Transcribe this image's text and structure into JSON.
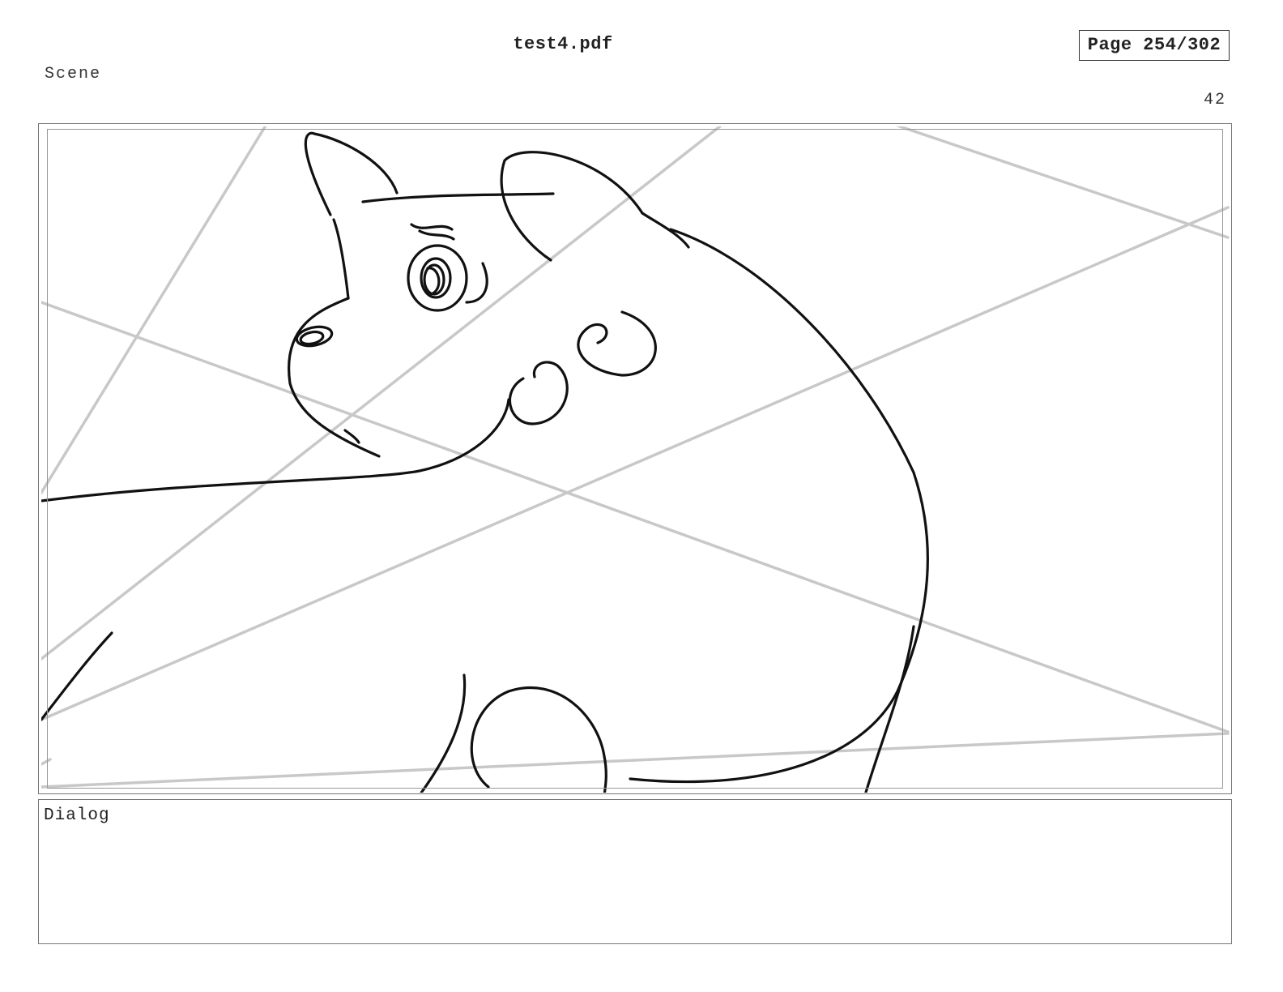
{
  "header": {
    "file_title": "test4.pdf",
    "page_indicator": "Page 254/302"
  },
  "panel": {
    "scene_label": "Scene",
    "shot_number": "42",
    "image_description_name": "storyboard-sketch"
  },
  "dialog": {
    "label": "Dialog",
    "text": ""
  },
  "colors": {
    "ink": "#111111",
    "guide_lines": "#c8c8c8",
    "frame_border": "#777777"
  }
}
